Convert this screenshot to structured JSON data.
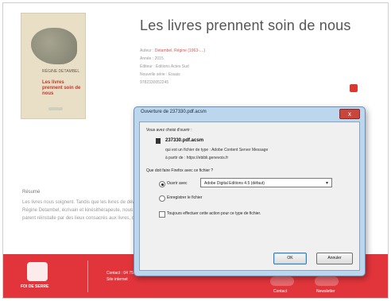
{
  "book": {
    "title": "Les livres prennent soin de nous",
    "meta": {
      "author_label": "Auteur",
      "author_value": "Detambel, Régine (1963-....)",
      "edition": "Année : 2015",
      "publisher": "Éditeur : Éditions Actes Sud",
      "collection": "Nouvelle série : Essais",
      "isbn": "9782330052245"
    },
    "cover": {
      "author": "RÉGINE DETAMBEL",
      "title": "Les livres prennent soin de nous"
    }
  },
  "description": {
    "heading": "Résumé",
    "lines": [
      "Les livres nous soignent. Tandis que les livres de développement personnel et les ouvrages de psychologie se multiplient en librairie,",
      "Régine Detambel, écrivain et kinésithérapeute, nous propose une bibliothérapie créative qui tourne le dos aux recettes toutes faites",
      "parent réinstalle par des lieux consacrés aux livres, ces matériaux primitifs de la transmission."
    ]
  },
  "footer": {
    "logo_text": "FOI DE SERRE",
    "text_line1": "Contact : 04 75 ...",
    "text_line2": "Site internet",
    "button1_label": "Contact",
    "button2_label": "Newsletter"
  },
  "dialog": {
    "title": "Ouverture de 237330.pdf.acsm",
    "section": "Vous avez choisi d'ouvrir :",
    "filename": "237330.pdf.acsm",
    "filetype": "qui est un fichier de type : Adobe Content Server Message",
    "from": "à partir de : https://ebibli.genevois.fr",
    "question": "Que doit faire Firefox avec ce fichier ?",
    "open_with_label": "Ouvrir avec",
    "open_with_value": "Adobe Digital Editions 4.5 (défaut)",
    "save_label": "Enregistrer le fichier",
    "remember_label": "Toujours effectuer cette action pour ce type de fichier.",
    "ok_label": "OK",
    "cancel_label": "Annuler",
    "close_label": "x"
  }
}
